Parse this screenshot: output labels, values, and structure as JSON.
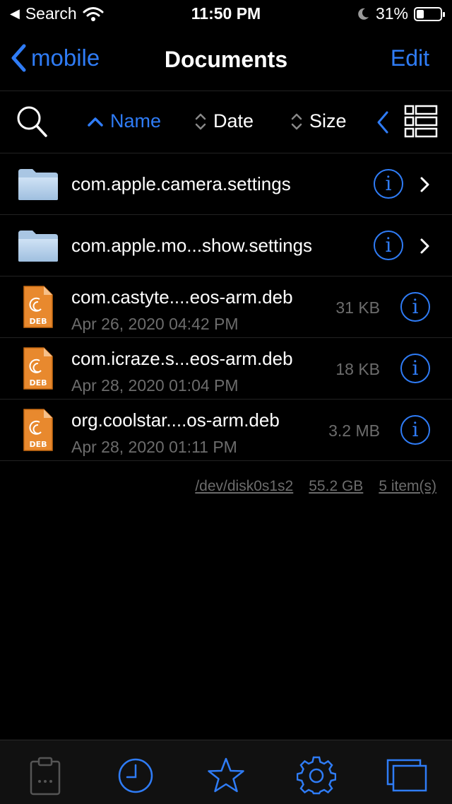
{
  "status_bar": {
    "back_app": "Search",
    "time": "11:50 PM",
    "battery_percent": "31%",
    "battery_level": 0.31
  },
  "nav": {
    "back_label": "mobile",
    "title": "Documents",
    "edit_label": "Edit"
  },
  "sort_bar": {
    "name_label": "Name",
    "date_label": "Date",
    "size_label": "Size",
    "active_sort": "Name"
  },
  "items": [
    {
      "type": "folder",
      "name": "com.apple.camera.settings"
    },
    {
      "type": "folder",
      "name": "com.apple.mo...show.settings"
    },
    {
      "type": "deb",
      "name": "com.castyte....eos-arm.deb",
      "date": "Apr 26, 2020 04:42 PM",
      "size": "31 KB",
      "badge": "DEB"
    },
    {
      "type": "deb",
      "name": "com.icraze.s...eos-arm.deb",
      "date": "Apr 28, 2020 01:04 PM",
      "size": "18 KB",
      "badge": "DEB"
    },
    {
      "type": "deb",
      "name": "org.coolstar....os-arm.deb",
      "date": "Apr 28, 2020 01:11 PM",
      "size": "3.2 MB",
      "badge": "DEB"
    }
  ],
  "footer": {
    "disk": "/dev/disk0s1s2",
    "free_space": "55.2 GB",
    "item_count": "5 item(s)"
  },
  "tab_bar": {
    "icons": [
      "clipboard-icon",
      "clock-icon",
      "star-icon",
      "gear-icon",
      "windows-icon"
    ]
  },
  "colors": {
    "accent": "#2f7cf6",
    "background": "#000000",
    "secondary_text": "#6c6c6c"
  }
}
